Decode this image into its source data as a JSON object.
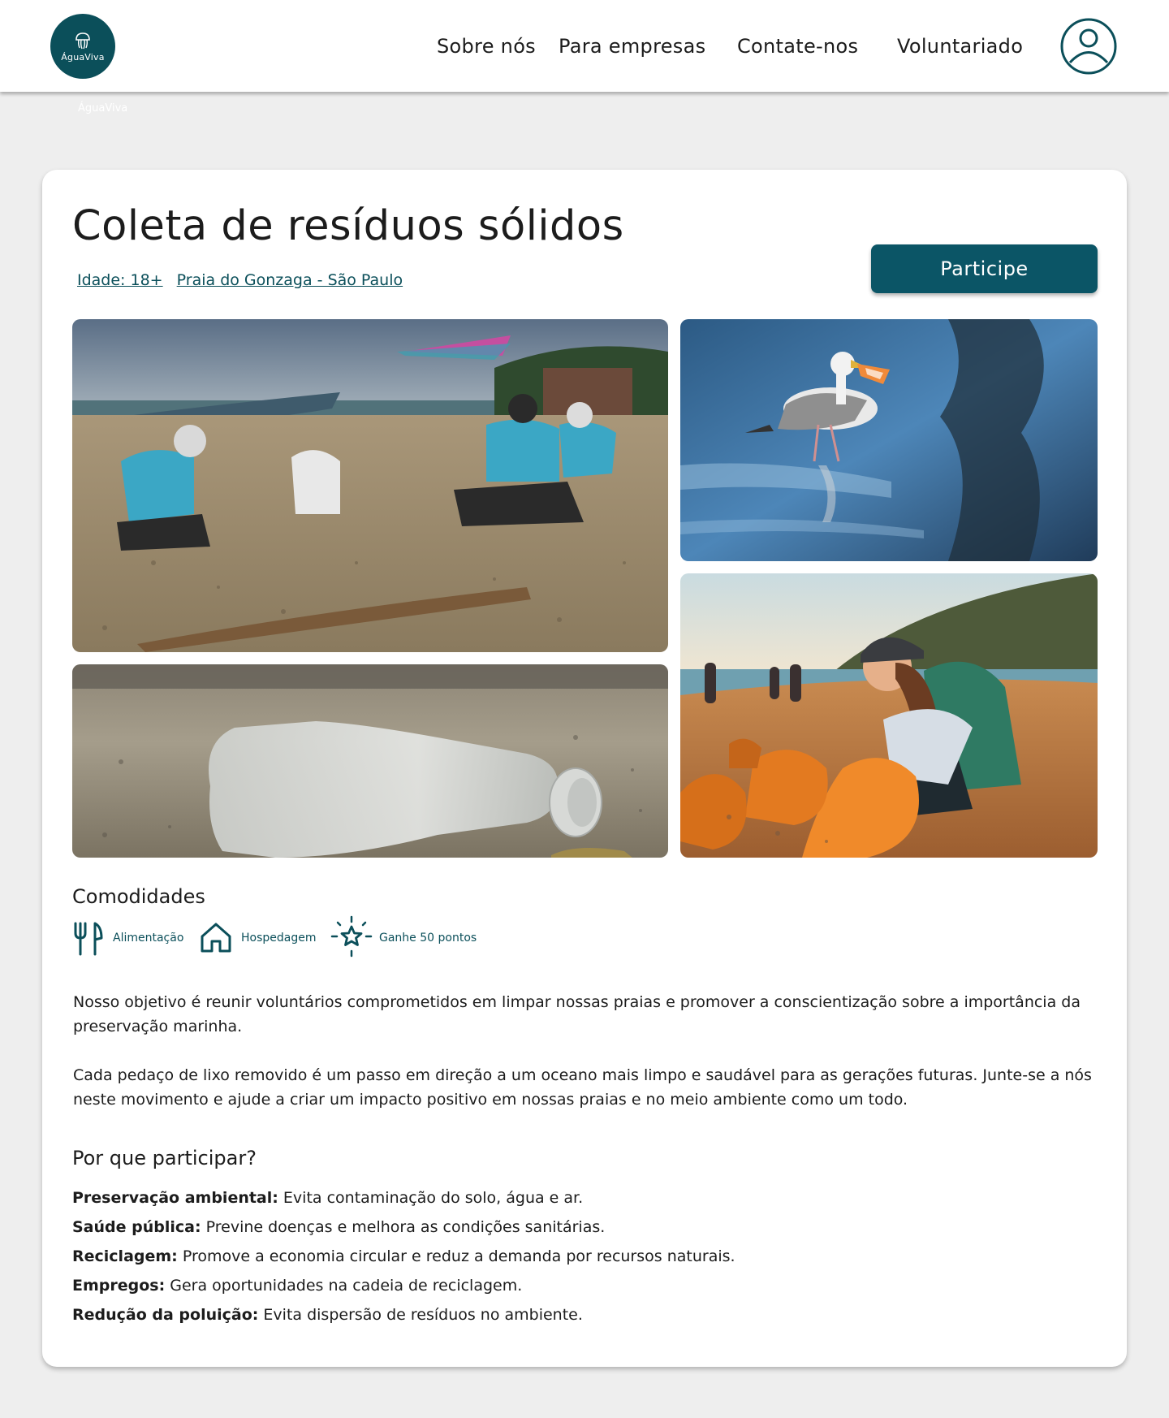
{
  "nav": {
    "logo_text": "ÁguaViva",
    "logo_ghost_text": "ÁguaViva",
    "links": [
      "Sobre nós",
      "Para empresas",
      "Contate-nos",
      "Voluntariado"
    ],
    "profile_icon": "user-circle-icon"
  },
  "event": {
    "title": "Coleta de resíduos sólidos",
    "age": "Idade: 18+",
    "location": "Praia do Gonzaga - São Paulo",
    "cta_label": "Participe"
  },
  "photos": [
    {
      "name": "volunteers-collecting-trash-photo"
    },
    {
      "name": "seagull-with-plastic-photo"
    },
    {
      "name": "plastic-bottle-on-sand-photo"
    },
    {
      "name": "woman-filling-orange-bags-photo"
    }
  ],
  "amenities": {
    "heading": "Comodidades",
    "items": [
      {
        "label": "Alimentação",
        "icon": "utensils-icon"
      },
      {
        "label": "Hospedagem",
        "icon": "house-icon"
      },
      {
        "label": "Ganhe 50 pontos",
        "icon": "star-sparkle-icon"
      }
    ]
  },
  "description": {
    "p1": "Nosso objetivo é reunir voluntários comprometidos em limpar nossas praias e promover a conscientização sobre a importância da preservação marinha.",
    "p2": "Cada pedaço de lixo removido é um passo em direção a um oceano mais limpo e saudável para as gerações futuras. Junte-se a nós neste movimento e ajude a criar um impacto positivo em nossas praias e no meio ambiente como um todo."
  },
  "why": {
    "heading": "Por que participar?",
    "reasons": [
      {
        "title": "Preservação ambiental:",
        "text": " Evita contaminação do solo, água e ar."
      },
      {
        "title": "Saúde pública:",
        "text": " Previne doenças e melhora as condições sanitárias."
      },
      {
        "title": "Reciclagem:",
        "text": " Promove a economia circular e reduz a demanda por recursos naturais."
      },
      {
        "title": "Empregos:",
        "text": " Gera oportunidades na cadeia de reciclagem."
      },
      {
        "title": "Redução da poluição:",
        "text": " Evita dispersão de resíduos no ambiente."
      }
    ]
  },
  "colors": {
    "brand": "#0b4f5a",
    "button": "#0b5566",
    "background": "#eeeeee",
    "card": "#ffffff"
  }
}
